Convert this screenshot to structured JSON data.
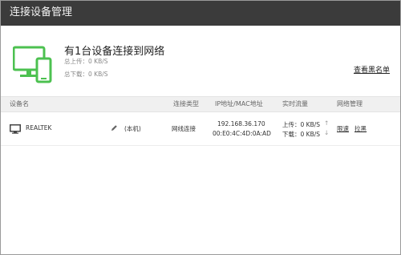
{
  "window": {
    "title": "连接设备管理"
  },
  "summary": {
    "title": "有1台设备连接到网络",
    "total_upload": "总上传：0 KB/S",
    "total_download": "总下载：0 KB/S",
    "blacklist_link": "查看黑名单"
  },
  "table": {
    "headers": [
      "设备名",
      "连接类型",
      "IP地址/MAC地址",
      "实时流量",
      "网络管理"
    ],
    "rows": [
      {
        "device_icon": "monitor-icon",
        "device_name": "REALTEK",
        "local_tag": "(本机)",
        "connection_type": "网线连接",
        "ip": "192.168.36.170",
        "mac": "00:E0:4C:4D:0A:AD",
        "upload": "上传：0 KB/S",
        "download": "下载：0 KB/S",
        "actions": [
          "限速",
          "拉黑"
        ]
      }
    ]
  },
  "colors": {
    "titlebar": "#3b3b3b",
    "accent_green": "#4cc150",
    "header_bg": "#f0f0f0"
  }
}
